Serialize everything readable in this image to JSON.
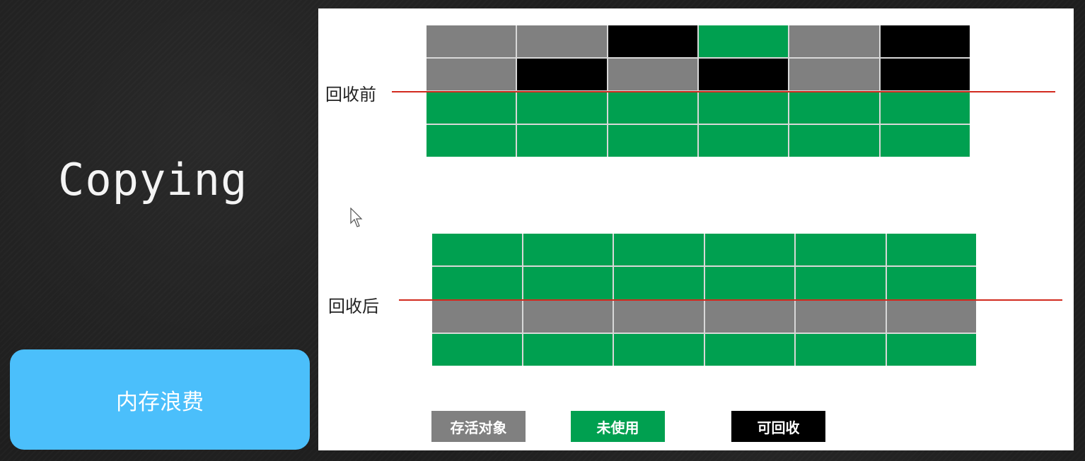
{
  "title": "Copying",
  "waste_label": "内存浪费",
  "colors": {
    "alive": "#808080",
    "unused": "#00a050",
    "garbage": "#000000",
    "accent_blue": "#4bbffb",
    "divider": "#d22a1e"
  },
  "before": {
    "label": "回收前",
    "rows": [
      [
        "alive",
        "alive",
        "garbage",
        "unused",
        "alive",
        "garbage"
      ],
      [
        "alive",
        "garbage",
        "alive",
        "garbage",
        "alive",
        "garbage"
      ],
      [
        "unused",
        "unused",
        "unused",
        "unused",
        "unused",
        "unused"
      ],
      [
        "unused",
        "unused",
        "unused",
        "unused",
        "unused",
        "unused"
      ]
    ]
  },
  "after": {
    "label": "回收后",
    "rows": [
      [
        "unused",
        "unused",
        "unused",
        "unused",
        "unused",
        "unused"
      ],
      [
        "unused",
        "unused",
        "unused",
        "unused",
        "unused",
        "unused"
      ],
      [
        "alive",
        "alive",
        "alive",
        "alive",
        "alive",
        "alive"
      ],
      [
        "unused",
        "unused",
        "unused",
        "unused",
        "unused",
        "unused"
      ]
    ]
  },
  "legend": {
    "alive": "存活对象",
    "unused": "未使用",
    "garbage": "可回收"
  }
}
